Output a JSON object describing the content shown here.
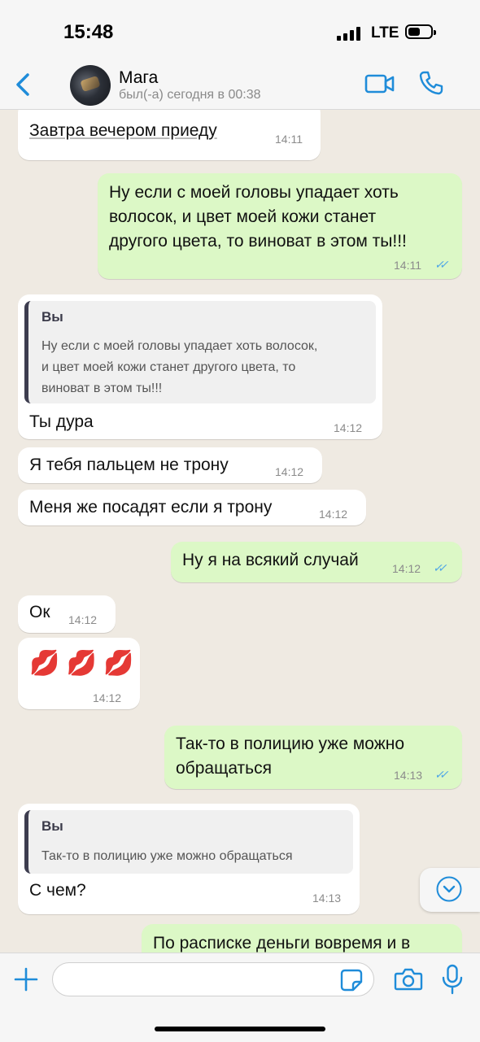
{
  "status_bar": {
    "time": "15:48",
    "network": "LTE"
  },
  "header": {
    "contact_name": "Мага",
    "contact_status": "был(-а) сегодня в 00:38"
  },
  "messages": [
    {
      "dir": "in",
      "text": "Завтра вечером приеду",
      "time": "14:11"
    },
    {
      "dir": "out",
      "text": "Ну если с моей головы упадает хоть\nволосок, и цвет моей кожи станет\nдругого цвета, то виноват в этом ты!!!",
      "time": "14:11"
    },
    {
      "dir": "in",
      "quote_author": "Вы",
      "quote_text": "Ну если с моей головы упадает хоть волосок,\nи цвет моей кожи станет другого цвета, то\nвиноват в этом ты!!!",
      "text": "Ты дура",
      "time": "14:12"
    },
    {
      "dir": "in",
      "text": "Я тебя пальцем не трону",
      "time": "14:12"
    },
    {
      "dir": "in",
      "text": "Меня же посадят если я трону",
      "time": "14:12"
    },
    {
      "dir": "out",
      "text": "Ну я на всякий случай",
      "time": "14:12"
    },
    {
      "dir": "in",
      "text": "Ок",
      "time": "14:12"
    },
    {
      "dir": "in",
      "text": "💋 💋 💋",
      "time": "14:12"
    },
    {
      "dir": "out",
      "text": "Так-то в полицию уже можно\nобращаться",
      "time": "14:13"
    },
    {
      "dir": "in",
      "quote_author": "Вы",
      "quote_text": "Так-то в полицию уже можно обращаться",
      "text": "С чем?",
      "time": "14:13"
    },
    {
      "dir": "out",
      "text": "По расписке деньги вовремя и в",
      "time": ""
    }
  ],
  "colors": {
    "accent": "#1f8cd9",
    "outgoing_bubble": "#dcf8c6",
    "incoming_bubble": "#ffffff",
    "chat_background": "#efeae2"
  },
  "icons": {
    "back": "chevron-left-icon",
    "video": "video-camera-icon",
    "call": "phone-icon",
    "scroll": "chevron-down-icon",
    "attach": "plus-icon",
    "sticker": "sticker-icon",
    "camera": "camera-icon",
    "mic": "microphone-icon"
  }
}
